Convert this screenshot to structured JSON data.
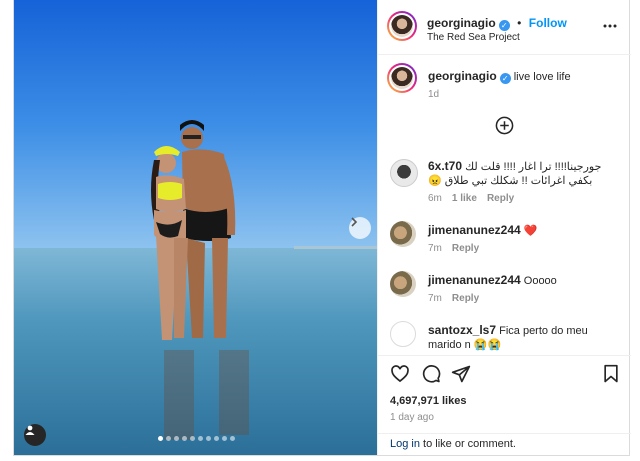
{
  "post": {
    "author": "georginagio",
    "follow_label": "Follow",
    "location": "The Red Sea Project",
    "caption": "live love life",
    "caption_age": "1d",
    "likes": "4,697,971 likes",
    "posted_ago": "1 day ago",
    "login_link": "Log in",
    "login_rest": " to like or comment.",
    "carousel_dots": 10,
    "carousel_active": 0
  },
  "comments": [
    {
      "user": "6x.t70",
      "text": "جورجينا!!!! ترا اغار !!!! قلت لك بكفي اغرائات !! شكلك تبي طلاق 😠",
      "age": "6m",
      "likes": "1 like",
      "reply": "Reply"
    },
    {
      "user": "jimenanunez244",
      "text": "❤️",
      "age": "7m",
      "reply": "Reply"
    },
    {
      "user": "jimenanunez244",
      "text": "Ooooo",
      "age": "7m",
      "reply": "Reply"
    },
    {
      "user": "santozx_ls7",
      "text": "Fica perto do meu marido n 😭😭",
      "age": "",
      "reply": ""
    }
  ],
  "colors": {
    "accent": "#0095f6",
    "verified": "#3897f0",
    "sky": "#1d6fd6",
    "sea": "#2f8ec4"
  },
  "icons": [
    "more-icon",
    "load-more-icon",
    "heart-icon",
    "comment-icon",
    "share-icon",
    "save-icon",
    "next-arrow-icon",
    "user-tag-icon"
  ]
}
